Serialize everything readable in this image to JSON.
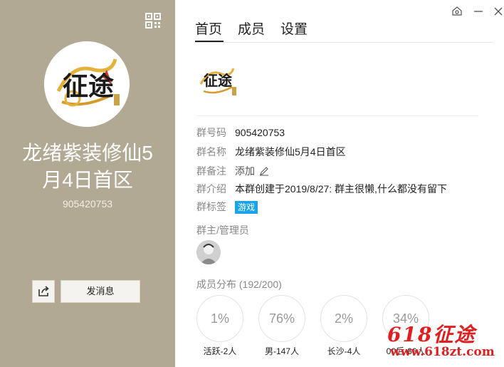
{
  "left_panel": {
    "group_name_line1": "龙绪紫装修仙5",
    "group_name_line2": "月4日首区",
    "group_number": "905420753",
    "send_message_label": "发消息",
    "avatar_text": "征途"
  },
  "tabs": [
    {
      "label": "首页",
      "active": true
    },
    {
      "label": "成员",
      "active": false
    },
    {
      "label": "设置",
      "active": false
    }
  ],
  "info": {
    "group_code_label": "群号码",
    "group_code_value": "905420753",
    "group_name_label": "群名称",
    "group_name_value": "龙绪紫装修仙5月4日首区",
    "remark_label": "群备注",
    "remark_value": "添加",
    "intro_label": "群介绍",
    "intro_value": "本群创建于2019/8/27:  群主很懒,什么都没有留下",
    "tags_label": "群标签",
    "tag_value": "游戏"
  },
  "admins": {
    "title": "群主/管理员"
  },
  "distribution": {
    "title": "成员分布 (192/200)",
    "stats": [
      {
        "percent": "1%",
        "label": "活跃-2人"
      },
      {
        "percent": "76%",
        "label": "男-147人"
      },
      {
        "percent": "2%",
        "label": "长沙-4人"
      },
      {
        "percent": "34%",
        "label": "00后-66人"
      }
    ]
  },
  "watermark": {
    "line1": "618征途",
    "line2": "www.618zt.com"
  },
  "colors": {
    "left_panel_bg": "#b2a995",
    "tag_bg": "#1aa3e8",
    "watermark": "#e02020"
  }
}
